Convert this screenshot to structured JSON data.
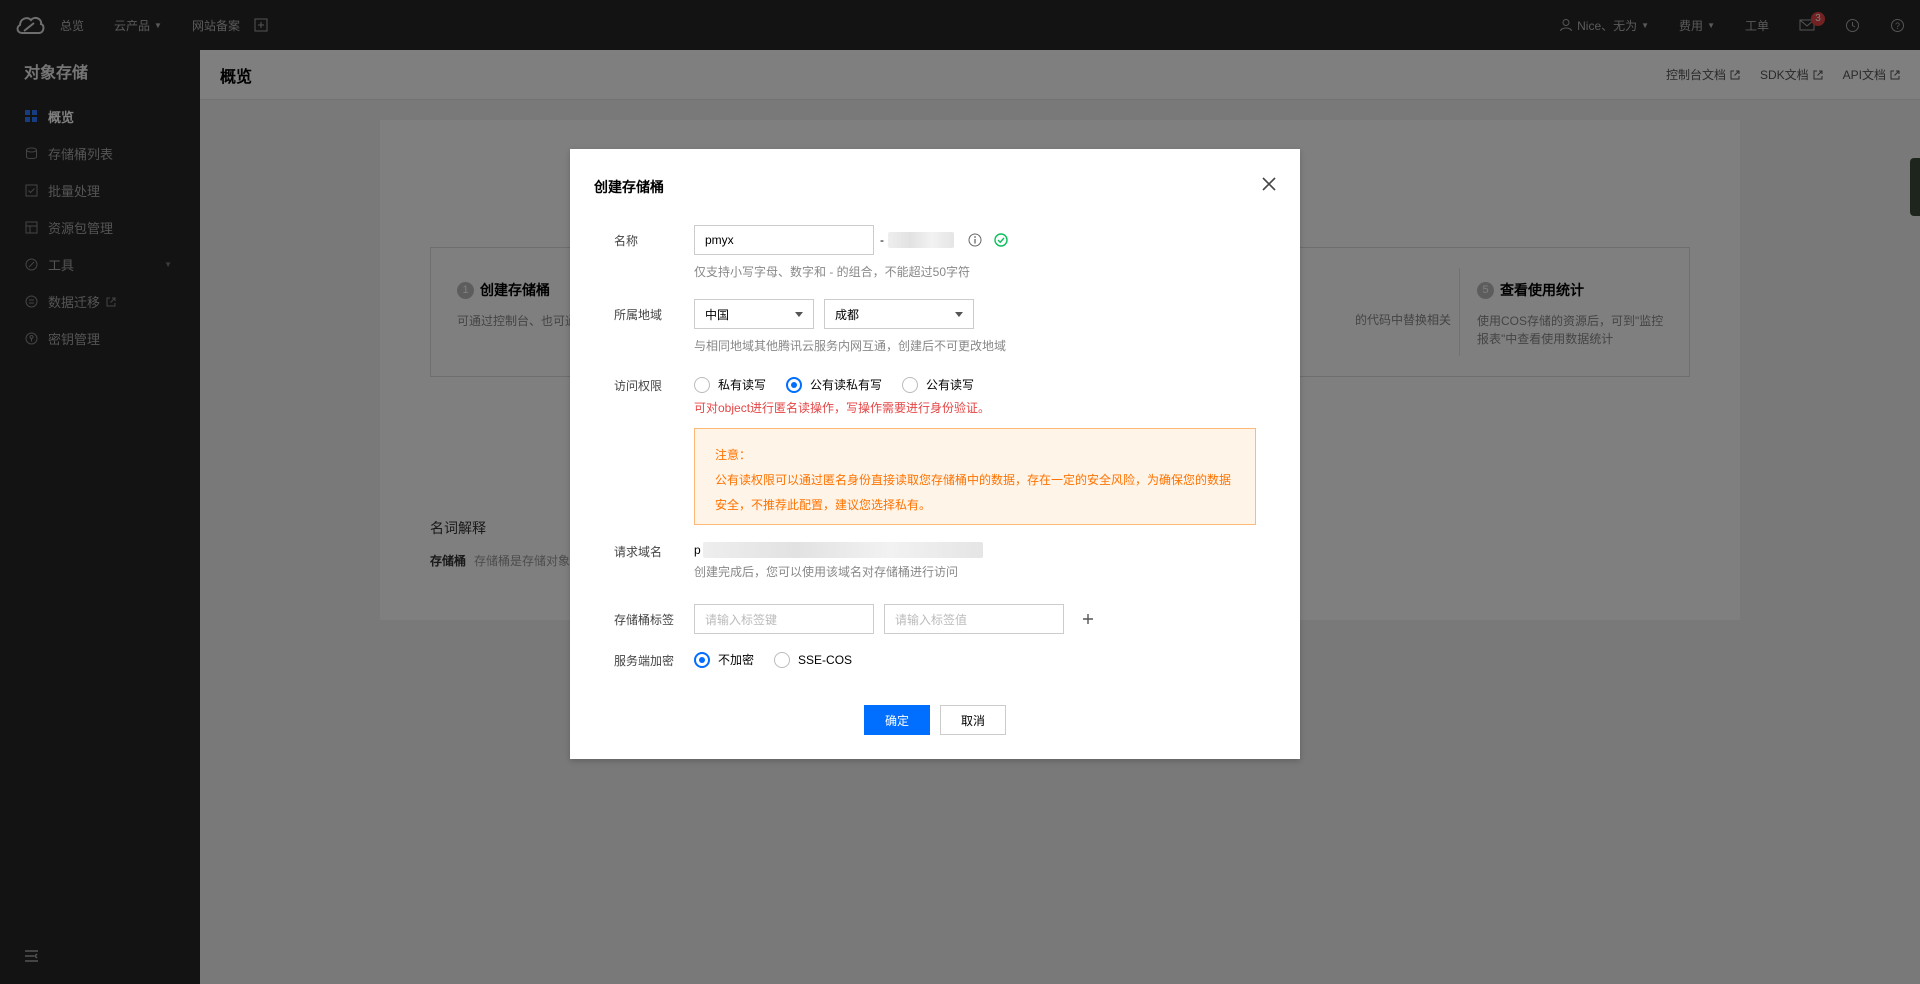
{
  "topbar": {
    "nav": [
      "总览",
      "云产品",
      "网站备案"
    ],
    "user": "Nice、无为",
    "billing": "费用",
    "ticket": "工单",
    "message_count": "3"
  },
  "sidebar": {
    "title": "对象存储",
    "items": [
      {
        "label": "概览",
        "icon": "grid-icon"
      },
      {
        "label": "存储桶列表",
        "icon": "bucket-icon"
      },
      {
        "label": "批量处理",
        "icon": "batch-icon"
      },
      {
        "label": "资源包管理",
        "icon": "package-icon"
      },
      {
        "label": "工具",
        "icon": "tool-icon"
      },
      {
        "label": "数据迁移",
        "icon": "migrate-icon"
      },
      {
        "label": "密钥管理",
        "icon": "key-icon"
      }
    ]
  },
  "page": {
    "title": "概览",
    "links": [
      "控制台文档",
      "SDK文档",
      "API文档"
    ],
    "steps": [
      {
        "num": "1",
        "title": "创建存储桶",
        "desc": "可通过控制台、也可通"
      },
      {
        "num": "5",
        "title": "查看使用统计",
        "desc": "使用COS存储的资源后，可到\"监控报表\"中查看使用数据统计"
      }
    ],
    "step_mid_desc": "的代码中替换相关",
    "glossary_title": "名词解释",
    "glossary_term": "存储桶",
    "glossary_desc": "存储桶是存储对象"
  },
  "dialog": {
    "title": "创建存储桶",
    "name": {
      "label": "名称",
      "value": "pmyx",
      "suffix": "-",
      "hint": "仅支持小写字母、数字和 - 的组合，不能超过50字符"
    },
    "region": {
      "label": "所属地域",
      "country": "中国",
      "city": "成都",
      "hint": "与相同地域其他腾讯云服务内网互通，创建后不可更改地域"
    },
    "access": {
      "label": "访问权限",
      "options": [
        "私有读写",
        "公有读私有写",
        "公有读写"
      ],
      "selected": "公有读私有写",
      "warning": "可对object进行匿名读操作，写操作需要进行身份验证。",
      "notice_title": "注意：",
      "notice_body": "公有读权限可以通过匿名身份直接读取您存储桶中的数据，存在一定的安全风险，为确保您的数据安全，不推荐此配置，建议您选择私有。"
    },
    "domain": {
      "label": "请求域名",
      "prefix": "p",
      "hint": "创建完成后，您可以使用该域名对存储桶进行访问"
    },
    "tags": {
      "label": "存储桶标签",
      "key_placeholder": "请输入标签键",
      "value_placeholder": "请输入标签值"
    },
    "encryption": {
      "label": "服务端加密",
      "options": [
        "不加密",
        "SSE-COS"
      ],
      "selected": "不加密"
    },
    "confirm": "确定",
    "cancel": "取消"
  }
}
